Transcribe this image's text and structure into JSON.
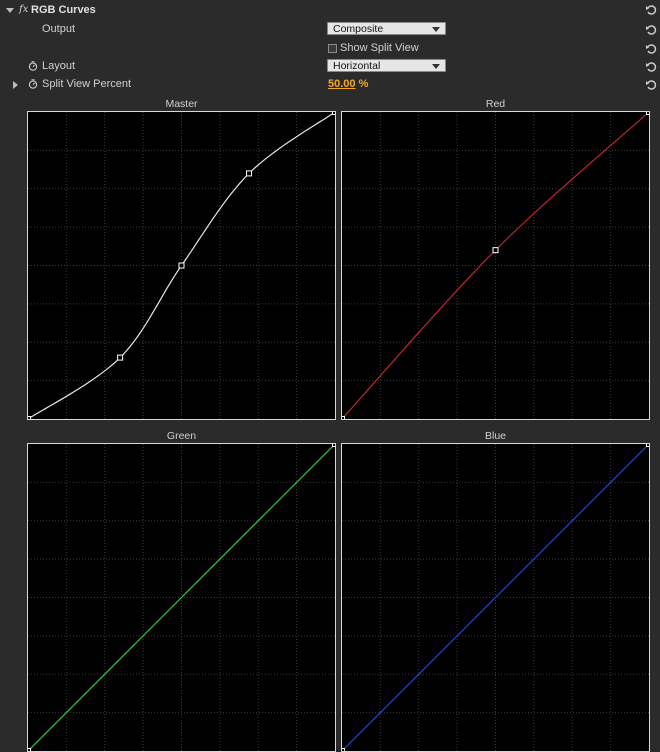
{
  "effect": {
    "fx_mark": "fx",
    "title": "RGB Curves"
  },
  "output": {
    "label": "Output",
    "value": "Composite"
  },
  "split_view": {
    "label": "Show Split View",
    "checked": false
  },
  "layout": {
    "label": "Layout",
    "value": "Horizontal"
  },
  "split_percent": {
    "label": "Split View Percent",
    "value": "50.00",
    "unit": "%"
  },
  "curves": {
    "master": {
      "title": "Master",
      "color": "#e8e8e8",
      "points": [
        [
          0,
          0
        ],
        [
          0.3,
          0.2
        ],
        [
          0.5,
          0.5
        ],
        [
          0.72,
          0.8
        ],
        [
          1,
          1
        ]
      ]
    },
    "red": {
      "title": "Red",
      "color": "#c0262d",
      "points": [
        [
          0,
          0
        ],
        [
          0.5,
          0.55
        ],
        [
          1,
          1
        ]
      ]
    },
    "green": {
      "title": "Green",
      "color": "#33c23a",
      "points": [
        [
          0,
          0
        ],
        [
          1,
          1
        ]
      ]
    },
    "blue": {
      "title": "Blue",
      "color": "#2a3fd0",
      "points": [
        [
          0,
          0
        ],
        [
          1,
          1
        ]
      ]
    }
  },
  "colors": {
    "background": "#2b2b2b",
    "accent_value": "#f5a623",
    "grid": "#3a3a3a",
    "curve_bg": "#000000"
  }
}
